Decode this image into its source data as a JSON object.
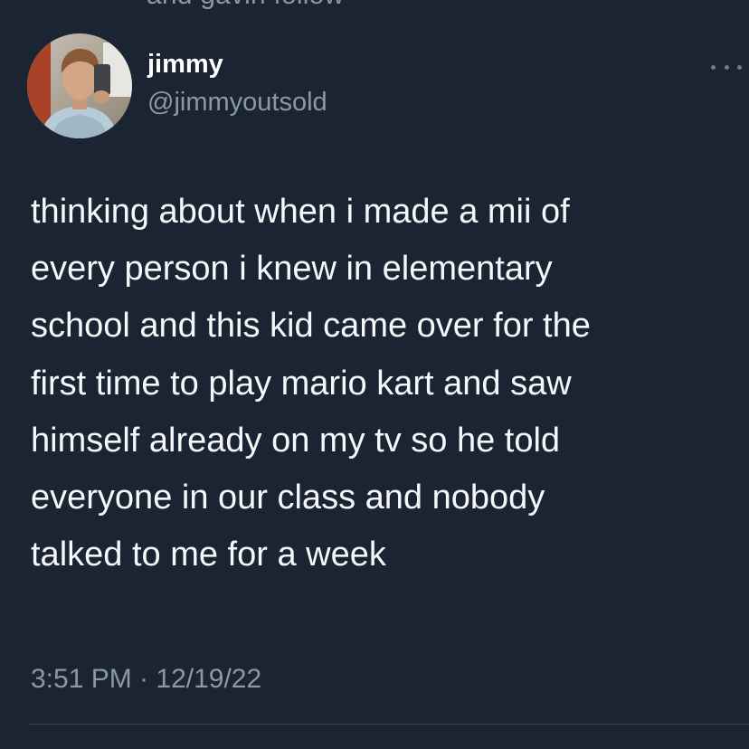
{
  "context": {
    "social_text": "and gavin follow"
  },
  "author": {
    "display_name": "jimmy",
    "handle": "@jimmyoutsold",
    "avatar_icon": "profile-photo"
  },
  "more_icon": "ellipsis-icon",
  "tweet": {
    "lines": [
      "thinking about when i made a mii of",
      "every person i knew in elementary",
      "school and this kid came over for the",
      "first time to play mario kart and saw",
      "himself already on my tv so he told",
      "everyone in our class and nobody",
      "talked to me for a week"
    ],
    "timestamp": "3:51 PM · 12/19/22"
  },
  "colors": {
    "background": "#1b2432",
    "text": "#f5f8fa",
    "secondary_text": "#8b98a5"
  }
}
